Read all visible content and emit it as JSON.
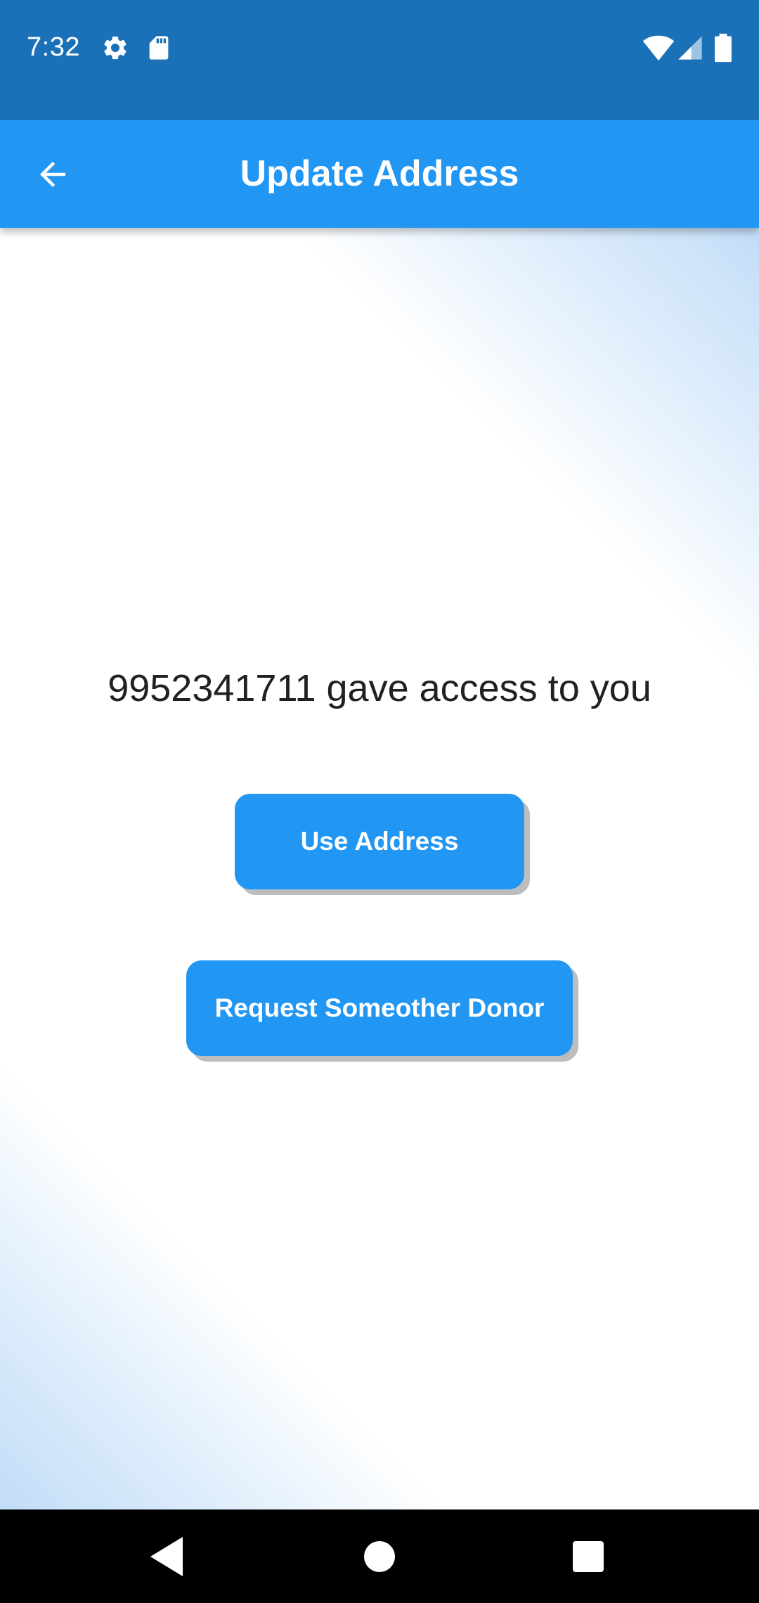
{
  "status_bar": {
    "time": "7:32",
    "icons": [
      "gear-icon",
      "sd-card-icon",
      "wifi-icon",
      "signal-icon",
      "battery-icon"
    ]
  },
  "app_bar": {
    "title": "Update Address",
    "back_icon": "arrow-back-icon"
  },
  "main": {
    "message": "9952341711 gave access to you",
    "use_address_label": "Use Address",
    "request_donor_label": "Request Someother Donor"
  },
  "nav_bar": {
    "icons": [
      "back-triangle-icon",
      "home-circle-icon",
      "recents-square-icon"
    ]
  },
  "colors": {
    "status_bar": "#1b71b8",
    "primary": "#2196f3",
    "text": "#212121",
    "button_shadow": "#bdbdbd"
  }
}
